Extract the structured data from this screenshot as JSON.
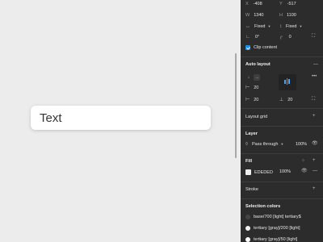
{
  "canvas": {
    "text_label": "Text"
  },
  "position": {
    "x_label": "X",
    "x_value": "-408",
    "y_label": "Y",
    "y_value": "-517"
  },
  "size": {
    "w_label": "W",
    "w_value": "1340",
    "h_label": "H",
    "h_value": "1100"
  },
  "resizing": {
    "horizontal": "Fixed",
    "vertical": "Fixed"
  },
  "corner": {
    "rotation": "0°",
    "radius": "0"
  },
  "clip": {
    "label": "Clip content"
  },
  "auto_layout": {
    "title": "Auto layout",
    "item_spacing": "20",
    "padding_h": "20",
    "padding_v": "20"
  },
  "layout_grid": {
    "title": "Layout grid"
  },
  "layer": {
    "title": "Layer",
    "blend_mode": "Pass through",
    "opacity": "100%"
  },
  "fill": {
    "title": "Fill",
    "hex": "EDEDED",
    "opacity": "100%",
    "color": "#EDEDED"
  },
  "stroke": {
    "title": "Stroke"
  },
  "selection_colors": {
    "title": "Selection colors",
    "items": [
      {
        "label": "base/700 [light] tertiary$",
        "color": "#444444"
      },
      {
        "label": "tertiary [gray]/200 [light]",
        "color": "#f2f2f2"
      },
      {
        "label": "tertiary [gray]/50 [light]",
        "color": "#ffffff"
      }
    ]
  },
  "colors": {
    "accent": "#1B8EF2",
    "panel_bg": "#2C2C2C"
  }
}
